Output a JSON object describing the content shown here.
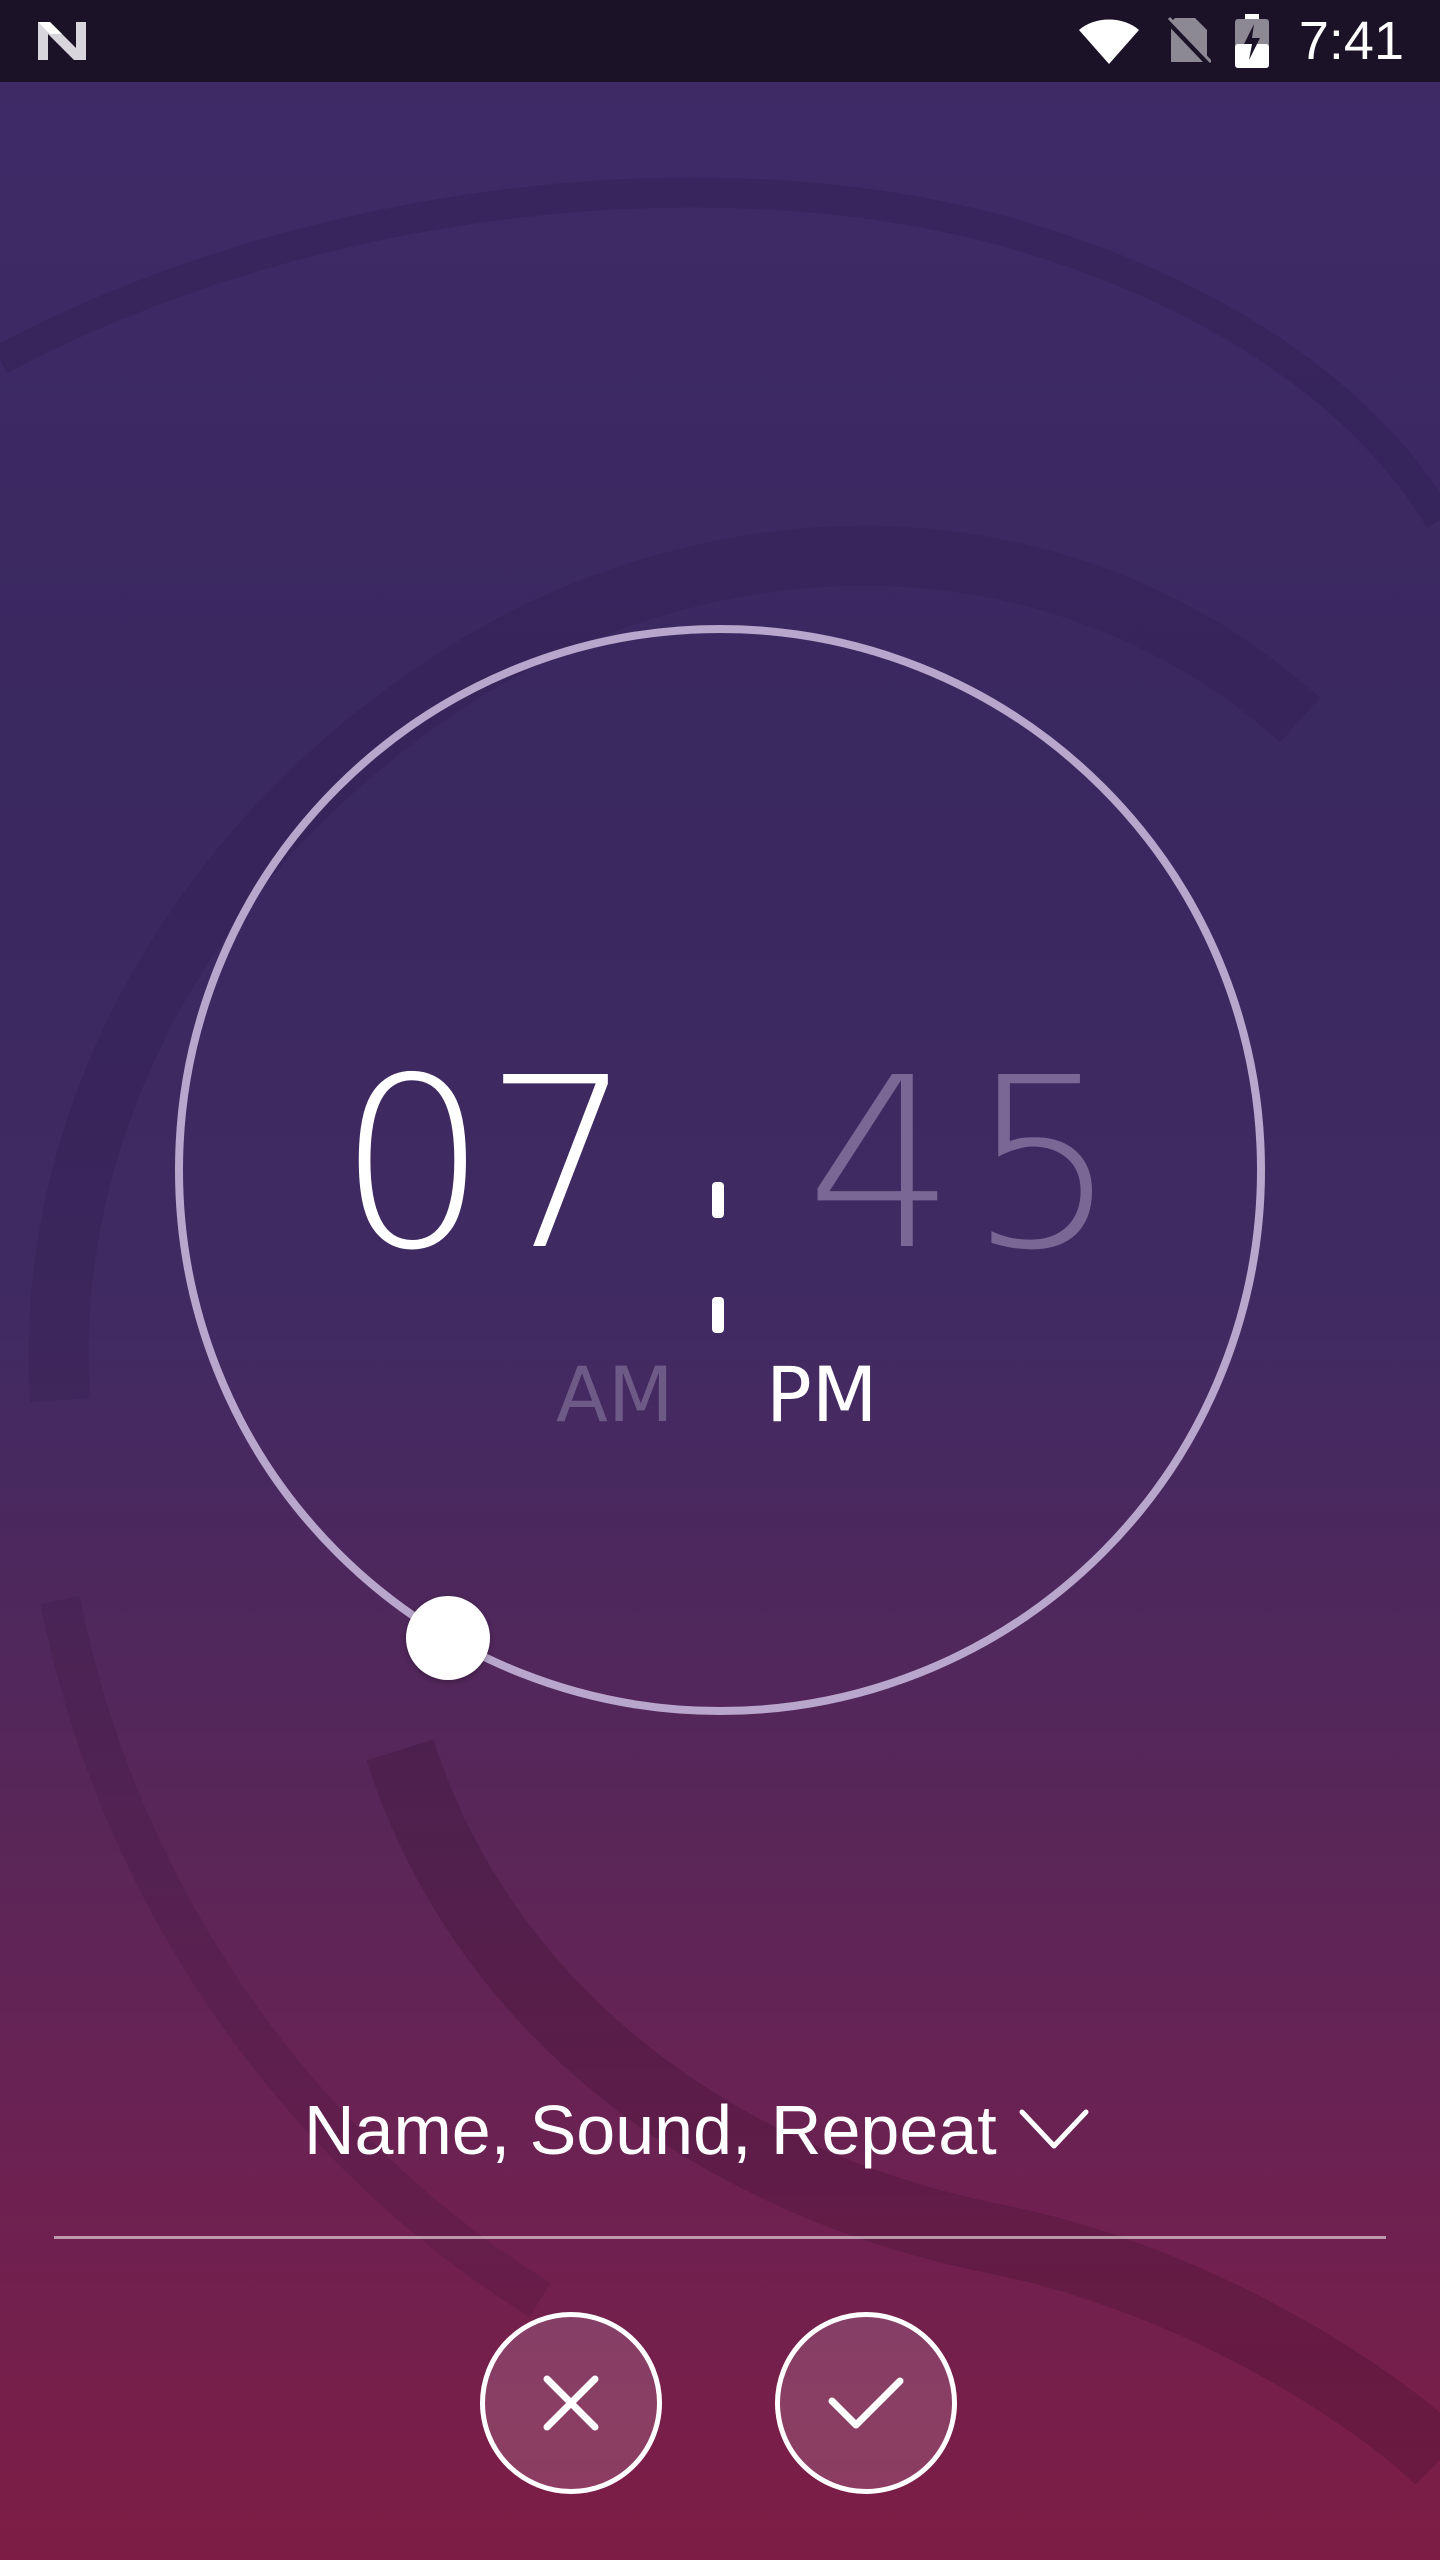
{
  "status_bar": {
    "time": "7:41",
    "icons": [
      "notification-n-icon",
      "wifi-icon",
      "no-sim-icon",
      "battery-charging-icon"
    ]
  },
  "time_picker": {
    "hours": "07",
    "minutes": "45",
    "am_label": "AM",
    "pm_label": "PM",
    "selected_period": "PM"
  },
  "options": {
    "label": "Name, Sound, Repeat",
    "expand_icon": "chevron-down-icon"
  },
  "actions": {
    "cancel_icon": "close-icon",
    "confirm_icon": "check-icon"
  },
  "colors": {
    "background_top": "#3f2b67",
    "background_bottom": "#7d1d45",
    "dial_ring": "#b9a6cc",
    "inactive_text": "#7b6795"
  }
}
